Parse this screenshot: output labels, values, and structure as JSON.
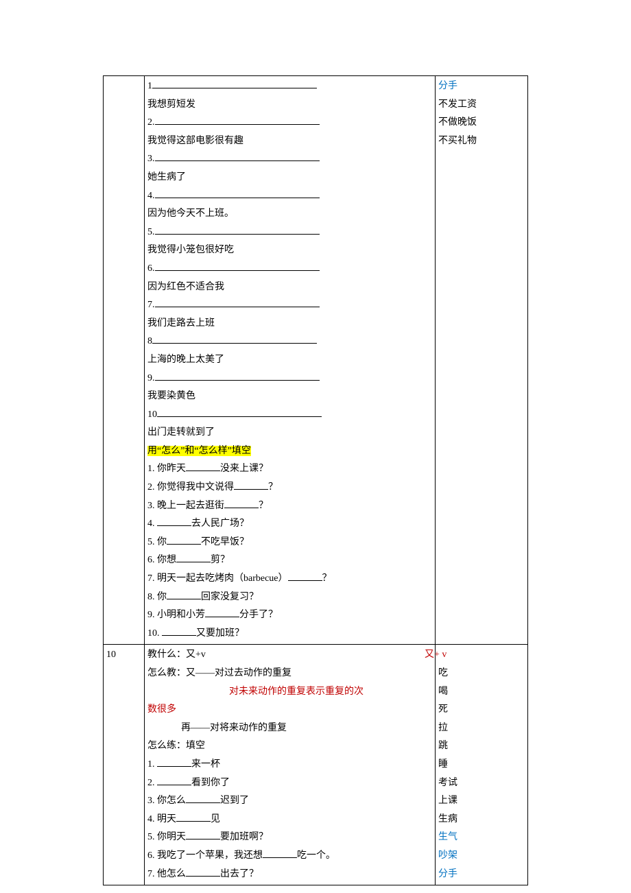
{
  "row1": {
    "col2": {
      "qa": [
        {
          "n": "1",
          "a": "我想剪短发"
        },
        {
          "n": "2.",
          "a": "我觉得这部电影很有趣"
        },
        {
          "n": "3.",
          "a": "她生病了"
        },
        {
          "n": "4.",
          "a": "因为他今天不上班。"
        },
        {
          "n": "5.",
          "a": "我觉得小笼包很好吃"
        },
        {
          "n": "6.",
          "a": "因为红色不适合我"
        },
        {
          "n": "7.",
          "a": "我们走路去上班"
        },
        {
          "n": "8",
          "a": "上海的晚上太美了"
        },
        {
          "n": "9.",
          "a": "我要染黄色"
        },
        {
          "n": "10",
          "a": "出门走转就到了"
        }
      ],
      "heading": "用“怎么”和“怎么样”填空",
      "fill": [
        {
          "pre": "1. 你昨天",
          "post": "没来上课？"
        },
        {
          "pre": "2. 你觉得我中文说得",
          "post": "？"
        },
        {
          "pre": "3. 晚上一起去逛街",
          "post": "？"
        },
        {
          "pre": "4. ",
          "post": "去人民广场？"
        },
        {
          "pre": "5. 你",
          "post": "不吃早饭？"
        },
        {
          "pre": "6. 你想",
          "post": "剪？"
        },
        {
          "pre": "7. 明天一起去吃烤肉（barbecue）",
          "post": "？"
        },
        {
          "pre": "8. 你",
          "post": "回家没复习？"
        },
        {
          "pre": "9. 小明和小芳",
          "post": "分手了？"
        },
        {
          "pre": "10. ",
          "post": "又要加班？"
        }
      ]
    },
    "col3": {
      "items": [
        {
          "t": "分手",
          "cls": "blue"
        },
        {
          "t": "不发工资",
          "cls": ""
        },
        {
          "t": "不做晚饭",
          "cls": ""
        },
        {
          "t": "不买礼物",
          "cls": ""
        }
      ]
    }
  },
  "row2": {
    "col1": "10",
    "col2": {
      "l1_a": "教什么：又+v",
      "l2_a": "怎么教：又——对过去动作的重复",
      "l3_a": "对未来动作的重复表示重复的次",
      "l4_a": "数很多",
      "l5_a": "再——对将来动作的重复",
      "l6": "怎么练：填空",
      "fill": [
        {
          "pre": "1. ",
          "post": "来一杯"
        },
        {
          "pre": "2. ",
          "post": "看到你了"
        },
        {
          "pre": "3. 你怎么",
          "post": "迟到了"
        },
        {
          "pre": "4. 明天",
          "post": "见"
        },
        {
          "pre": "5. 你明天",
          "post": "要加班啊？"
        },
        {
          "pre": "6. 我吃了一个苹果，我还想",
          "post": "吃一个。"
        },
        {
          "pre": "7. 他怎么",
          "post": "出去了？"
        }
      ]
    },
    "col3": {
      "head": "又+ v",
      "items": [
        {
          "t": "吃",
          "cls": ""
        },
        {
          "t": "喝",
          "cls": ""
        },
        {
          "t": "死",
          "cls": ""
        },
        {
          "t": "拉",
          "cls": ""
        },
        {
          "t": "跳",
          "cls": ""
        },
        {
          "t": "睡",
          "cls": ""
        },
        {
          "t": "考试",
          "cls": ""
        },
        {
          "t": "上课",
          "cls": ""
        },
        {
          "t": "生病",
          "cls": ""
        },
        {
          "t": "生气",
          "cls": "blue"
        },
        {
          "t": "吵架",
          "cls": "blue"
        },
        {
          "t": "分手",
          "cls": "blue"
        }
      ]
    }
  }
}
